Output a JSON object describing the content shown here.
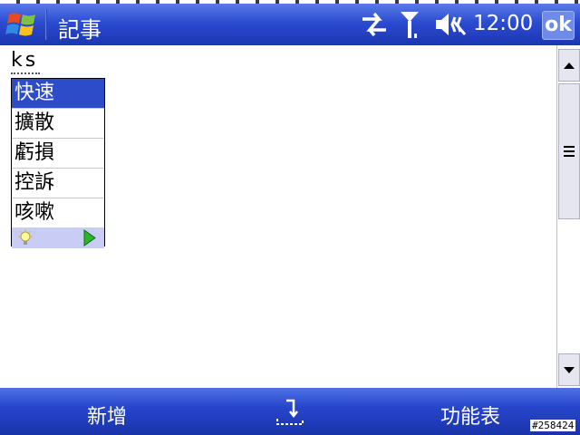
{
  "titlebar": {
    "app_title": "記事",
    "clock": "12:00",
    "ok_label": "ok",
    "icons": [
      "windows-start-icon",
      "connectivity-icon",
      "signal-icon",
      "volume-mute-icon"
    ]
  },
  "document": {
    "typed_text": "ks"
  },
  "candidates": {
    "items": [
      {
        "text": "快速",
        "selected": true
      },
      {
        "text": "擴散",
        "selected": false
      },
      {
        "text": "虧損",
        "selected": false
      },
      {
        "text": "控訴",
        "selected": false
      },
      {
        "text": "咳嗽",
        "selected": false
      }
    ],
    "footer_icons": [
      "lightbulb-icon",
      "next-page-icon"
    ]
  },
  "softkeys": {
    "left": "新增",
    "right": "功能表",
    "center_icon": "input-panel-icon"
  },
  "build_tag": "#258424",
  "colors": {
    "titlebar": "#2b4bd1",
    "selection": "#2d4cc9",
    "candidate_footer": "#c9cdf6",
    "play_arrow": "#2cb52c"
  }
}
